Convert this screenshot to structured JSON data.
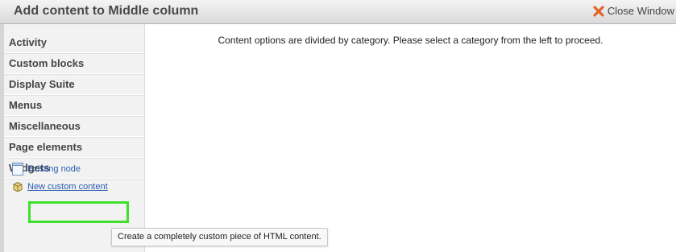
{
  "header": {
    "title": "Add content to Middle column",
    "close_label": "Close Window",
    "close_icon": "close-x-icon"
  },
  "sidebar": {
    "categories": [
      {
        "label": "Activity"
      },
      {
        "label": "Custom blocks"
      },
      {
        "label": "Display Suite"
      },
      {
        "label": "Menus"
      },
      {
        "label": "Miscellaneous"
      },
      {
        "label": "Page elements"
      },
      {
        "label": "Widgets"
      }
    ],
    "extras": [
      {
        "label": "Existing node",
        "icon": "node-icon"
      },
      {
        "label": "New custom content",
        "icon": "custom-content-icon"
      }
    ]
  },
  "main": {
    "message": "Content options are divided by category. Please select a category from the left to proceed."
  },
  "tooltip": {
    "text": "Create a completely custom piece of HTML content."
  },
  "colors": {
    "highlight": "#3ee02a",
    "link": "#2a5db0",
    "close_icon": "#e0642a"
  }
}
